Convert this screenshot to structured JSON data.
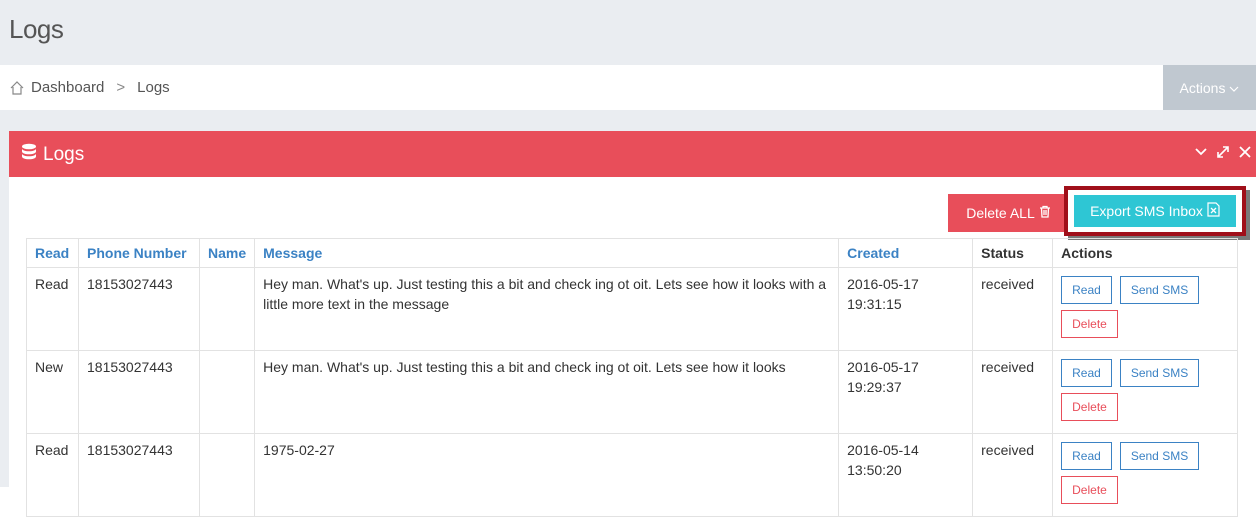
{
  "page": {
    "title": "Logs"
  },
  "breadcrumb": {
    "items": [
      "Dashboard",
      "Logs"
    ],
    "separator": ">"
  },
  "actions_dropdown": {
    "label": "Actions"
  },
  "panel": {
    "title": "Logs",
    "tools": [
      "chevron-down-icon",
      "expand-icon",
      "close-icon"
    ],
    "accent_color": "#e84e5a"
  },
  "toolbar": {
    "delete_all_label": "Delete ALL",
    "export_label": "Export SMS Inbox"
  },
  "table": {
    "headers": {
      "read": "Read",
      "phone": "Phone Number",
      "name": "Name",
      "message": "Message",
      "created": "Created",
      "status": "Status",
      "actions": "Actions"
    },
    "rows": [
      {
        "read": "Read",
        "phone": "18153027443",
        "name": "",
        "message": "Hey man. What's up. Just testing this a bit and check ing ot oit. Lets see how it looks with a little more text in the message",
        "created_date": "2016-05-17",
        "created_time": "19:31:15",
        "status": "received"
      },
      {
        "read": "New",
        "phone": "18153027443",
        "name": "",
        "message": "Hey man. What's up. Just testing this a bit and check ing ot oit. Lets see how it looks",
        "created_date": "2016-05-17",
        "created_time": "19:29:37",
        "status": "received"
      },
      {
        "read": "Read",
        "phone": "18153027443",
        "name": "",
        "message": "1975-02-27",
        "created_date": "2016-05-14",
        "created_time": "13:50:20",
        "status": "received"
      }
    ],
    "row_actions": {
      "read": "Read",
      "send_sms": "Send SMS",
      "delete": "Delete"
    }
  }
}
